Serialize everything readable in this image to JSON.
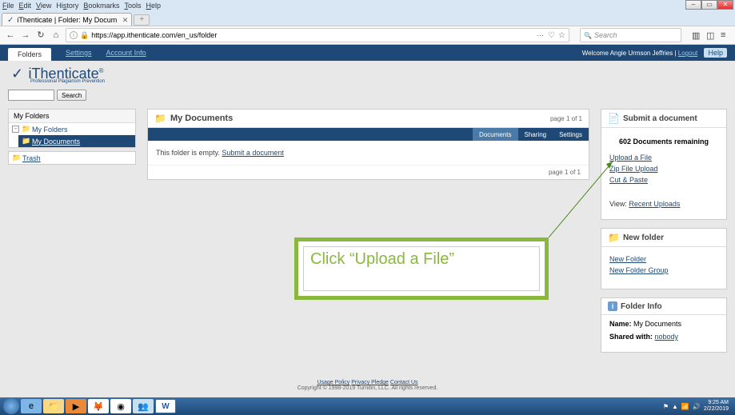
{
  "menubar": [
    "File",
    "Edit",
    "View",
    "History",
    "Bookmarks",
    "Tools",
    "Help"
  ],
  "tab": {
    "title": "iThenticate | Folder: My Docum"
  },
  "url": "https://app.ithenticate.com/en_us/folder",
  "search_placeholder": "Search",
  "ithen": {
    "tab": "Folders",
    "links": [
      "Settings",
      "Account Info"
    ],
    "welcome": "Welcome Angie Urmson Jeffries | ",
    "logout": "Logout",
    "help": "Help"
  },
  "logo": {
    "brand": "iThenticate",
    "tag": "Professional Plagiarism Prevention"
  },
  "searchbox": {
    "button": "Search"
  },
  "sidebar": {
    "title": "My Folders",
    "root": "My Folders",
    "docs": "My Documents",
    "trash": "Trash"
  },
  "main_panel": {
    "title": "My Documents",
    "pager": "page 1 of 1",
    "tabs": [
      "Documents",
      "Sharing",
      "Settings"
    ],
    "empty_prefix": "This folder is empty. ",
    "empty_link": "Submit a document"
  },
  "submit": {
    "title": "Submit a document",
    "remaining": "602 Documents remaining",
    "upload_file": "Upload a File",
    "zip": "Zip File Upload",
    "cut_paste": "Cut & Paste",
    "view_label": "View:",
    "recent": "Recent Uploads"
  },
  "newfolder": {
    "title": "New folder",
    "nf": "New Folder",
    "nfg": "New Folder Group"
  },
  "folderinfo": {
    "title": "Folder Info",
    "name_label": "Name:",
    "name": "My Documents",
    "shared_label": "Shared with:",
    "shared": "nobody"
  },
  "callout": "Click “Upload a File”",
  "footer": {
    "links": [
      "Usage Policy",
      "Privacy Pledge",
      "Contact Us"
    ],
    "copy": "Copyright © 1998-2019 Turnitin, LLC. All rights reserved."
  },
  "clock": {
    "time": "9:25 AM",
    "date": "2/22/2019"
  }
}
